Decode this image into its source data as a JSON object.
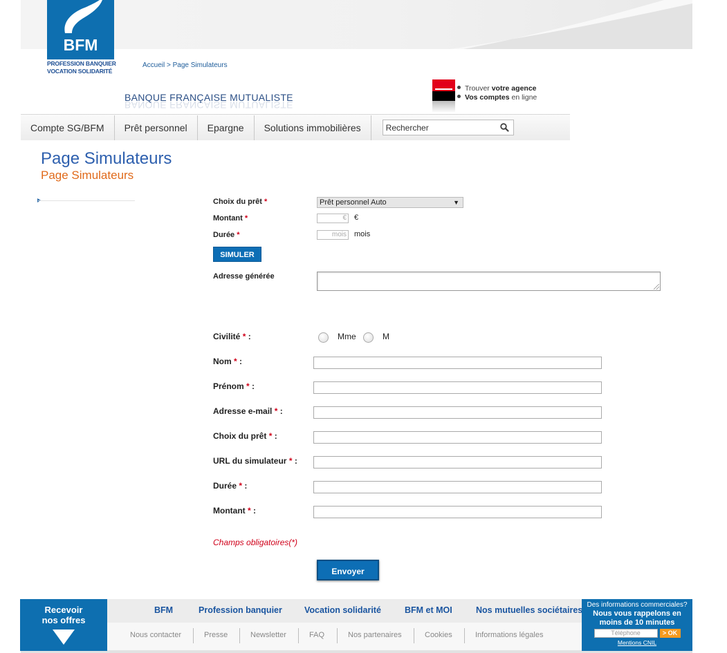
{
  "header": {
    "logo_text": "BFM",
    "logo_tagline_1": "Profession Banquier",
    "logo_tagline_2": "Vocation Solidarité",
    "breadcrumb": "Accueil > Page Simulateurs",
    "bank_name": "BANQUE FRANÇAISE MUTUALISTE",
    "agency_link_prefix": "Trouver ",
    "agency_link_bold": "votre agence",
    "accounts_link_bold": "Vos comptes",
    "accounts_link_suffix": " en ligne"
  },
  "nav": {
    "items": [
      {
        "label": "Compte SG/BFM"
      },
      {
        "label": "Prêt personnel"
      },
      {
        "label": "Epargne"
      },
      {
        "label": "Solutions immobilières"
      }
    ],
    "search_placeholder": "Rechercher"
  },
  "page": {
    "title": "Page Simulateurs",
    "subtitle": "Page Simulateurs"
  },
  "simulator": {
    "loan_choice_label": "Choix du prêt",
    "loan_choice_value": "Prêt personnel Auto",
    "amount_label": "Montant",
    "amount_placeholder": "€",
    "amount_unit": "€",
    "duration_label": "Durée",
    "duration_placeholder": "mois",
    "duration_unit": "mois",
    "simulate_button": "SIMULER",
    "generated_address_label": "Adresse générée",
    "required_mark": "*"
  },
  "contact_form": {
    "civility_label": "Civilité",
    "civility_options": [
      "Mme",
      "M"
    ],
    "fields": [
      {
        "label": "Nom"
      },
      {
        "label": "Prénom"
      },
      {
        "label": "Adresse e-mail"
      },
      {
        "label": "Choix du prêt"
      },
      {
        "label": "URL du simulateur"
      },
      {
        "label": "Durée"
      },
      {
        "label": "Montant"
      }
    ],
    "colon": " :",
    "mandatory_note": "Champs obligatoires(*)",
    "submit_button": "Envoyer"
  },
  "footer": {
    "receive_line1": "Recevoir",
    "receive_line2": "nos offres",
    "main_links": [
      "BFM",
      "Profession banquier",
      "Vocation solidarité",
      "BFM et MOI",
      "Nos mutuelles sociétaires"
    ],
    "sub_links": [
      "Nous contacter",
      "Presse",
      "Newsletter",
      "FAQ",
      "Nos partenaires",
      "Cookies",
      "Informations légales"
    ],
    "callback_line1": "Des informations commerciales?",
    "callback_line2": "Nous vous rappelons en",
    "callback_line3": "moins de 10 minutes",
    "phone_placeholder": "Téléphone",
    "ok_button": "> OK",
    "cnil_link": "Mentions CNIL"
  },
  "colors": {
    "brand_blue": "#0e6fb0",
    "title_blue": "#2d5fae",
    "subtitle_orange": "#e06a1b",
    "required_red": "#d0021b",
    "sg_red": "#e2001a"
  }
}
